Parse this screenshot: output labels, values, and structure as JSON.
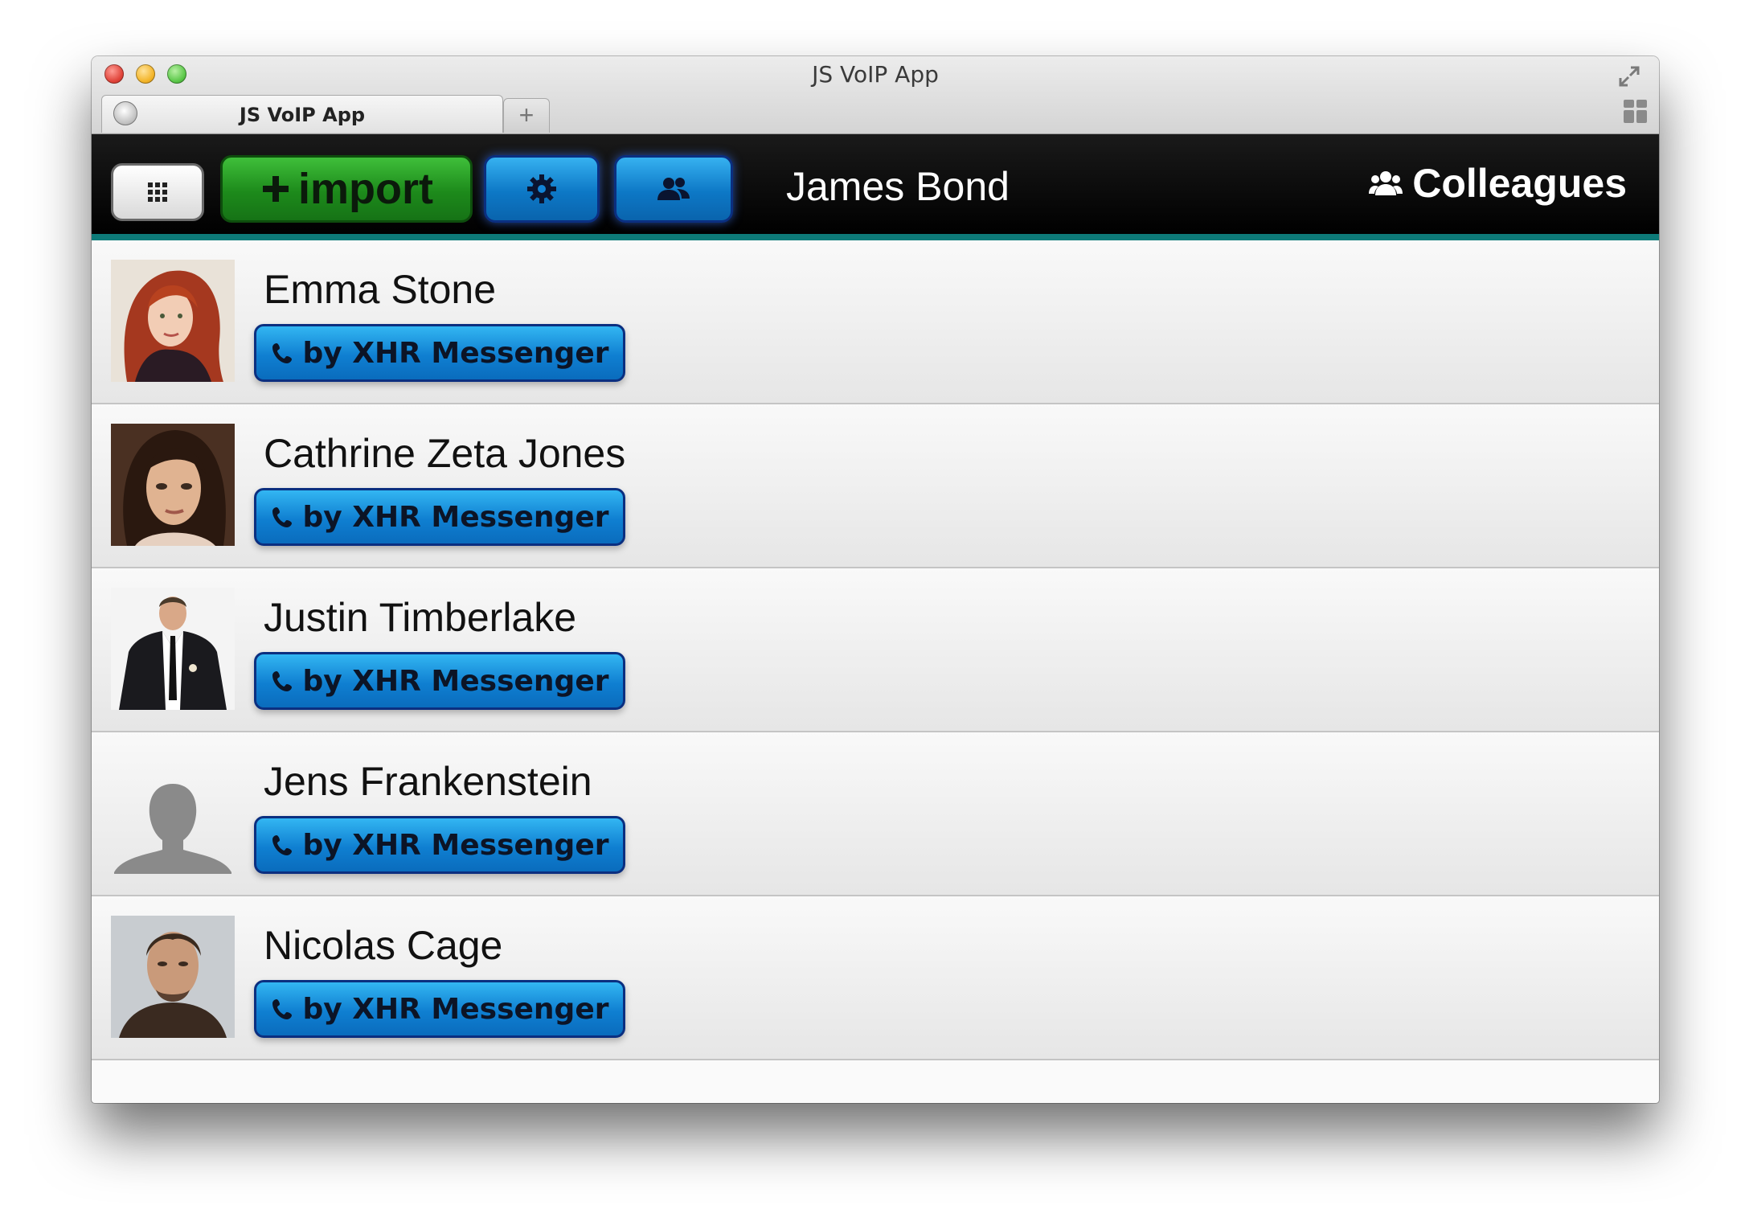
{
  "window": {
    "title": "JS VoIP App",
    "tab_label": "JS VoIP App",
    "new_tab_label": "+"
  },
  "header": {
    "import_label": "import",
    "user_name": "James Bond",
    "group_label": "Colleagues",
    "accent_color": "#0d7a78"
  },
  "contacts": [
    {
      "name": "Emma Stone",
      "call_label": "by XHR Messenger",
      "avatar": "photo"
    },
    {
      "name": "Cathrine Zeta Jones",
      "call_label": "by XHR Messenger",
      "avatar": "photo"
    },
    {
      "name": "Justin Timberlake",
      "call_label": "by XHR Messenger",
      "avatar": "photo"
    },
    {
      "name": "Jens Frankenstein",
      "call_label": "by XHR Messenger",
      "avatar": "silhouette"
    },
    {
      "name": "Nicolas Cage",
      "call_label": "by XHR Messenger",
      "avatar": "photo"
    }
  ],
  "icons": {
    "apps": "grid-icon",
    "import": "plus-icon",
    "settings": "gear-icon",
    "contacts": "people-icon",
    "call": "phone-icon"
  }
}
